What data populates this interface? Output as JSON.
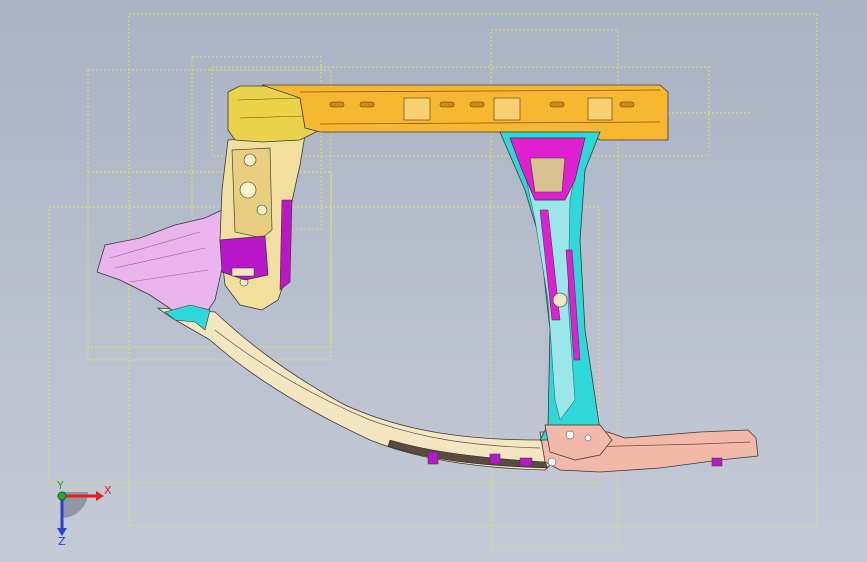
{
  "viewport": {
    "background_top": "#aab3c4",
    "background_bottom": "#c5cbd6"
  },
  "triad": {
    "x_label": "X",
    "y_label": "Y",
    "z_label": "Z",
    "x_color": "#e0201c",
    "y_color": "#22a82a",
    "z_color": "#2244cc"
  },
  "part_colors": {
    "roof_rail": "#f5b830",
    "a_pillar_upper": "#e9d34a",
    "a_pillar_inner": "#f2dfa0",
    "b_pillar_outer": "#2fd8d8",
    "b_pillar_top": "#e020d0",
    "hinge_reinf": "#b818c8",
    "front_panel": "#eab4ec",
    "sill_rear": "#f2b8a8",
    "sill_cream": "#f3e6c0",
    "bounding_box": "#e8e060"
  }
}
